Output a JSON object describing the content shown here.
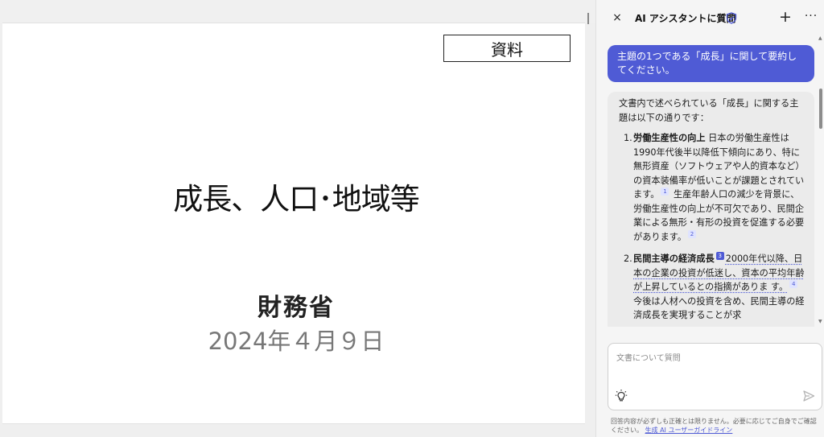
{
  "document": {
    "tag_label": "資料",
    "title": "成長、人口･地域等",
    "organization": "財務省",
    "date": "2024年４月９日"
  },
  "assistant": {
    "header": {
      "close_label": "×",
      "title": "AI アシスタントに質問",
      "new_label": "+",
      "more_label": "···"
    },
    "user_message": "主題の1つである「成長」に関して要約してください。",
    "ai_response": {
      "intro": "文書内で述べられている「成長」に関する主題は以下の通りです：",
      "items": [
        {
          "number": "1.",
          "heading": "労働生産性の向上",
          "text1": " 日本の労働生産性は1990年代後半以降低下傾向にあり、特に無形資産（ソフトウェアや人的資本など）の資本装備率が低いことが課題とされています。",
          "cite1": "1",
          "text2": " 生産年齢人口の減少を背景に、労働生産性の向上が不可欠であり、民間企業による無形・有形の投資を促進する必要があります。",
          "cite2": "2"
        },
        {
          "number": "2.",
          "heading": "民間主導の経済成長",
          "cite1": "3",
          "text1": "2000年代以降、日本の企業の投資が低迷し、資本の平均年齢が上昇しているとの指摘がありま す。",
          "cite2": "4",
          "text2": " 今後は人材への投資を含め、民間主導の経済成長を実現することが求"
        }
      ]
    },
    "input": {
      "placeholder": "文書について質問",
      "value": ""
    },
    "disclaimer": {
      "text": "回答内容が必ずしも正確とは限りません。必要に応じてご自身でご確認ください。",
      "link": "生成 AI ユーザーガイドライン"
    },
    "colors": {
      "accent": "#4f5bd5",
      "ai_bubble": "#ebebeb",
      "panel_bg": "#f5f5f5"
    }
  }
}
